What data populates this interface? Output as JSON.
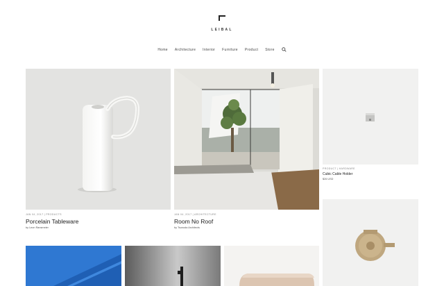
{
  "brand": {
    "name": "LEIBAL"
  },
  "nav": {
    "items": [
      "Home",
      "Architecture",
      "Interior",
      "Furniture",
      "Product",
      "Store"
    ],
    "search_icon": "search-icon"
  },
  "posts": [
    {
      "meta": "JAN 04, 2017 | PRODUCTS",
      "title": "Porcelain Tableware",
      "byline": "by Leon Ransmeier"
    },
    {
      "meta": "JAN 04, 2017 | ARCHITECTURE",
      "title": "Room No Roof",
      "byline": "by Tsunoda Architects"
    },
    {
      "meta": "PRODUCT | HARDWARE",
      "title": "Cubic Cable Holder",
      "byline": "$26 USD"
    }
  ]
}
